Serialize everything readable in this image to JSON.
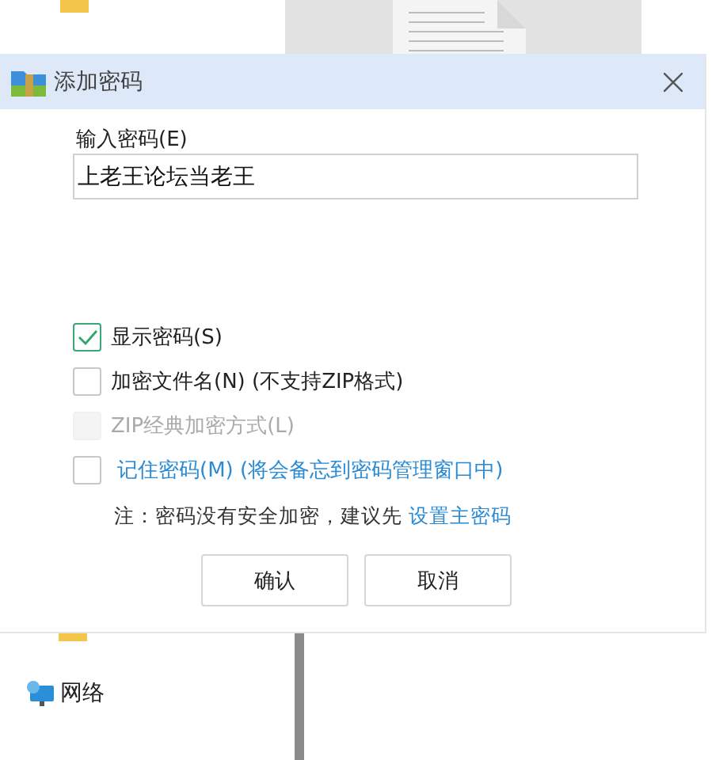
{
  "explorer": {
    "nav_items": [
      {
        "label": "网络"
      }
    ]
  },
  "dialog": {
    "title": "添加密码",
    "password_label": "输入密码(E)",
    "password_value": "上老王论坛当老王",
    "options": [
      {
        "kind": "checkbox",
        "label": "显示密码(S)",
        "checked": true,
        "disabled": false
      },
      {
        "kind": "checkbox",
        "label": "加密文件名(N) (不支持ZIP格式)",
        "checked": false,
        "disabled": false
      },
      {
        "kind": "checkbox",
        "label": "ZIP经典加密方式(L)",
        "checked": false,
        "disabled": true
      },
      {
        "kind": "link",
        "label": "记住密码(M) (将会备忘到密码管理窗口中)",
        "checked": false,
        "disabled": false
      }
    ],
    "note": {
      "text": "注：密码没有安全加密，建议先",
      "link": "设置主密码"
    },
    "buttons": [
      "确认",
      "取消"
    ]
  }
}
